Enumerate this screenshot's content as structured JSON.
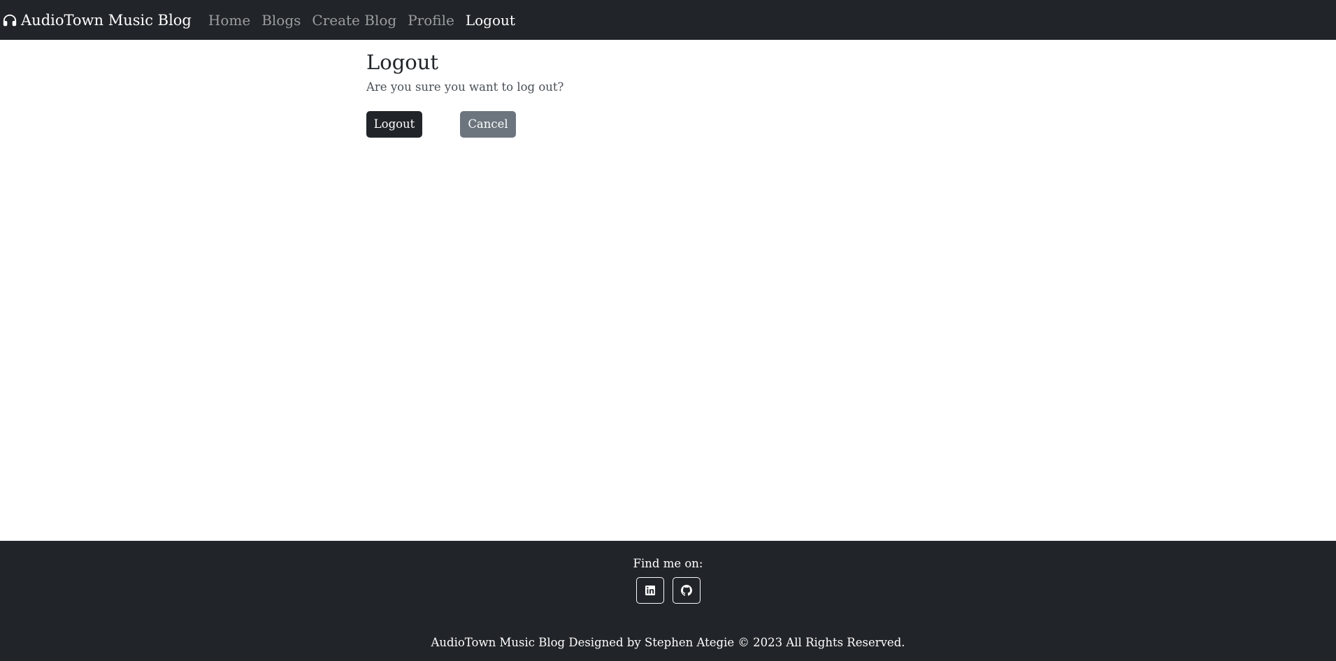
{
  "navbar": {
    "brand_icon": "headphones-icon",
    "brand_label": "AudioTown Music Blog",
    "links": [
      {
        "label": "Home",
        "active": false
      },
      {
        "label": "Blogs",
        "active": false
      },
      {
        "label": "Create Blog",
        "active": false
      },
      {
        "label": "Profile",
        "active": false
      },
      {
        "label": "Logout",
        "active": true
      }
    ]
  },
  "main": {
    "title": "Logout",
    "message": "Are you sure you want to log out?",
    "logout_button": "Logout",
    "cancel_button": "Cancel"
  },
  "footer": {
    "find_label": "Find me on:",
    "social": [
      {
        "icon": "linkedin-icon"
      },
      {
        "icon": "github-icon"
      }
    ],
    "copyright": "AudioTown Music Blog Designed by Stephen Ategie © 2023 All Rights Reserved."
  },
  "colors": {
    "nav_bg": "#212529",
    "nav_link": "rgba(255,255,255,0.55)",
    "primary_button": "#212529",
    "secondary_button": "#6c757d"
  }
}
